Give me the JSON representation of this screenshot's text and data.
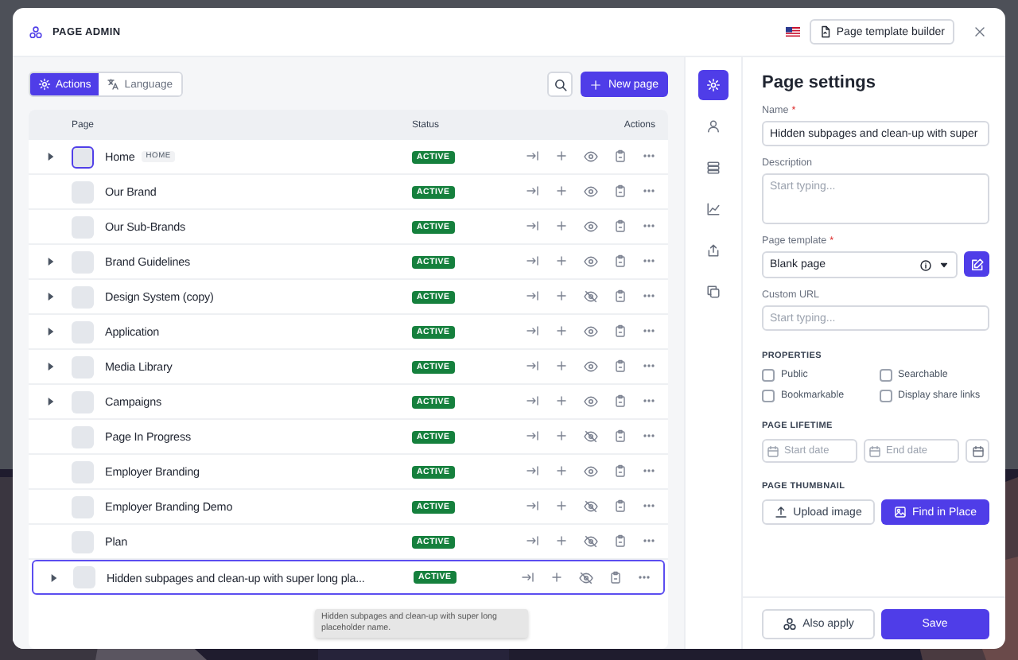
{
  "header": {
    "title": "PAGE ADMIN",
    "template_builder_button": "Page template builder"
  },
  "toolbar": {
    "tabs": [
      {
        "label": "Actions",
        "selected": true
      },
      {
        "label": "Language",
        "selected": false
      }
    ],
    "new_page_button": "New page"
  },
  "table": {
    "columns": [
      "Page",
      "Status",
      "Actions"
    ],
    "rows": [
      {
        "name": "Home",
        "badge": "HOME",
        "status": "ACTIVE",
        "expandable": true,
        "visible": true,
        "thumbnail_focused": true,
        "selected": false
      },
      {
        "name": "Our Brand",
        "status": "ACTIVE",
        "expandable": false,
        "visible": true,
        "thumbnail_focused": false,
        "selected": false
      },
      {
        "name": "Our Sub-Brands",
        "status": "ACTIVE",
        "expandable": false,
        "visible": true,
        "thumbnail_focused": false,
        "selected": false
      },
      {
        "name": "Brand Guidelines",
        "status": "ACTIVE",
        "expandable": true,
        "visible": true,
        "thumbnail_focused": false,
        "selected": false
      },
      {
        "name": "Design System (copy)",
        "status": "ACTIVE",
        "expandable": true,
        "visible": false,
        "thumbnail_focused": false,
        "selected": false
      },
      {
        "name": "Application",
        "status": "ACTIVE",
        "expandable": true,
        "visible": true,
        "thumbnail_focused": false,
        "selected": false
      },
      {
        "name": "Media Library",
        "status": "ACTIVE",
        "expandable": true,
        "visible": true,
        "thumbnail_focused": false,
        "selected": false
      },
      {
        "name": "Campaigns",
        "status": "ACTIVE",
        "expandable": true,
        "visible": true,
        "thumbnail_focused": false,
        "selected": false
      },
      {
        "name": "Page In Progress",
        "status": "ACTIVE",
        "expandable": false,
        "visible": false,
        "thumbnail_focused": false,
        "selected": false
      },
      {
        "name": "Employer Branding",
        "status": "ACTIVE",
        "expandable": false,
        "visible": true,
        "thumbnail_focused": false,
        "selected": false
      },
      {
        "name": "Employer Branding Demo",
        "status": "ACTIVE",
        "expandable": false,
        "visible": false,
        "thumbnail_focused": false,
        "selected": false
      },
      {
        "name": "Plan",
        "status": "ACTIVE",
        "expandable": false,
        "visible": false,
        "thumbnail_focused": false,
        "selected": false
      },
      {
        "name": "Hidden subpages and clean-up with super long pla...",
        "status": "ACTIVE",
        "expandable": true,
        "visible": false,
        "thumbnail_focused": false,
        "selected": true
      }
    ]
  },
  "tooltip": "Hidden subpages and clean-up with super long placeholder name.",
  "rail": [
    {
      "kind": "settings",
      "selected": true
    },
    {
      "kind": "user",
      "selected": false
    },
    {
      "kind": "stack",
      "selected": false
    },
    {
      "kind": "chart",
      "selected": false
    },
    {
      "kind": "share",
      "selected": false
    },
    {
      "kind": "copy",
      "selected": false
    }
  ],
  "settings": {
    "title": "Page settings",
    "name": {
      "label": "Name",
      "required_mark": "*",
      "value": "Hidden subpages and clean-up with super"
    },
    "description": {
      "label": "Description",
      "placeholder": "Start typing..."
    },
    "template": {
      "label": "Page template",
      "required_mark": "*",
      "value": "Blank page"
    },
    "custom_url": {
      "label": "Custom URL",
      "placeholder": "Start typing..."
    },
    "properties": {
      "title": "PROPERTIES",
      "options": [
        {
          "label": "Public",
          "checked": false
        },
        {
          "label": "Searchable",
          "checked": false
        },
        {
          "label": "Bookmarkable",
          "checked": false
        },
        {
          "label": "Display share links",
          "checked": false
        }
      ]
    },
    "lifetime": {
      "title": "PAGE LIFETIME",
      "start_placeholder": "Start date",
      "end_placeholder": "End date"
    },
    "thumbnail": {
      "title": "PAGE THUMBNAIL",
      "upload_button": "Upload image",
      "find_button": "Find in Place"
    }
  },
  "footer": {
    "also_apply_button": "Also apply",
    "save_button": "Save"
  }
}
